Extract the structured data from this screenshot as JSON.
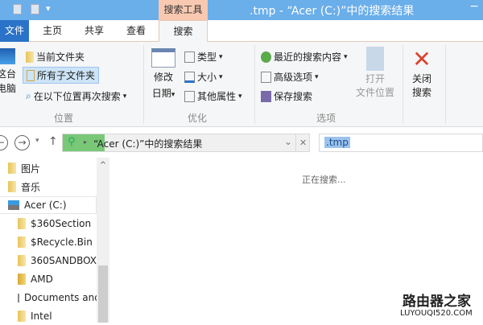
{
  "titlebar": {
    "title": ".tmp - “Acer (C:)”中的搜索结果",
    "context_tab": "搜索工具",
    "minimize": "−",
    "quick_access_dropdown": "▾"
  },
  "tabs": {
    "file": "文件",
    "home": "主页",
    "share": "共享",
    "view": "查看",
    "search": "搜索"
  },
  "ribbon": {
    "location": {
      "this_pc": [
        "这台",
        "电脑"
      ],
      "current_folder": "当前文件夹",
      "all_subfolders": "所有子文件夹",
      "search_again": "在以下位置再次搜索",
      "label": "位置"
    },
    "refine": {
      "date_modified": [
        "修改",
        "日期"
      ],
      "type": "类型",
      "size": "大小",
      "other_props": "其他属性",
      "label": "优化"
    },
    "options": {
      "recent": "最近的搜索内容",
      "advanced": "高级选项",
      "save": "保存搜索",
      "open_location": [
        "打开",
        "文件位置"
      ],
      "label": "选项"
    },
    "close": {
      "label": [
        "关闭",
        "搜索"
      ]
    }
  },
  "nav": {
    "back": "←",
    "forward": "→",
    "recent": "▾",
    "up": "↑",
    "address": "“Acer (C:)”中的搜索结果",
    "progress_percent": 17,
    "dropdown": "⌄",
    "clear": "✕",
    "search_value": ".tmp"
  },
  "sidebar": {
    "items": [
      "图片",
      "音乐",
      "Acer (C:)",
      "$360Section",
      "$Recycle.Bin",
      "360SANDBOX",
      "AMD",
      "Documents and Settings",
      "Intel"
    ],
    "scroll_up": "^"
  },
  "content": {
    "status": "正在搜索..."
  },
  "watermark": {
    "text1": "路由器之家",
    "text2": "LUYOUQI520.COM"
  },
  "colors": {
    "titlebar": "#6aaeea",
    "context": "#f8c9b0",
    "file_tab": "#2b73c8",
    "progress": "#78c878",
    "selection": "#9cc3ee"
  }
}
